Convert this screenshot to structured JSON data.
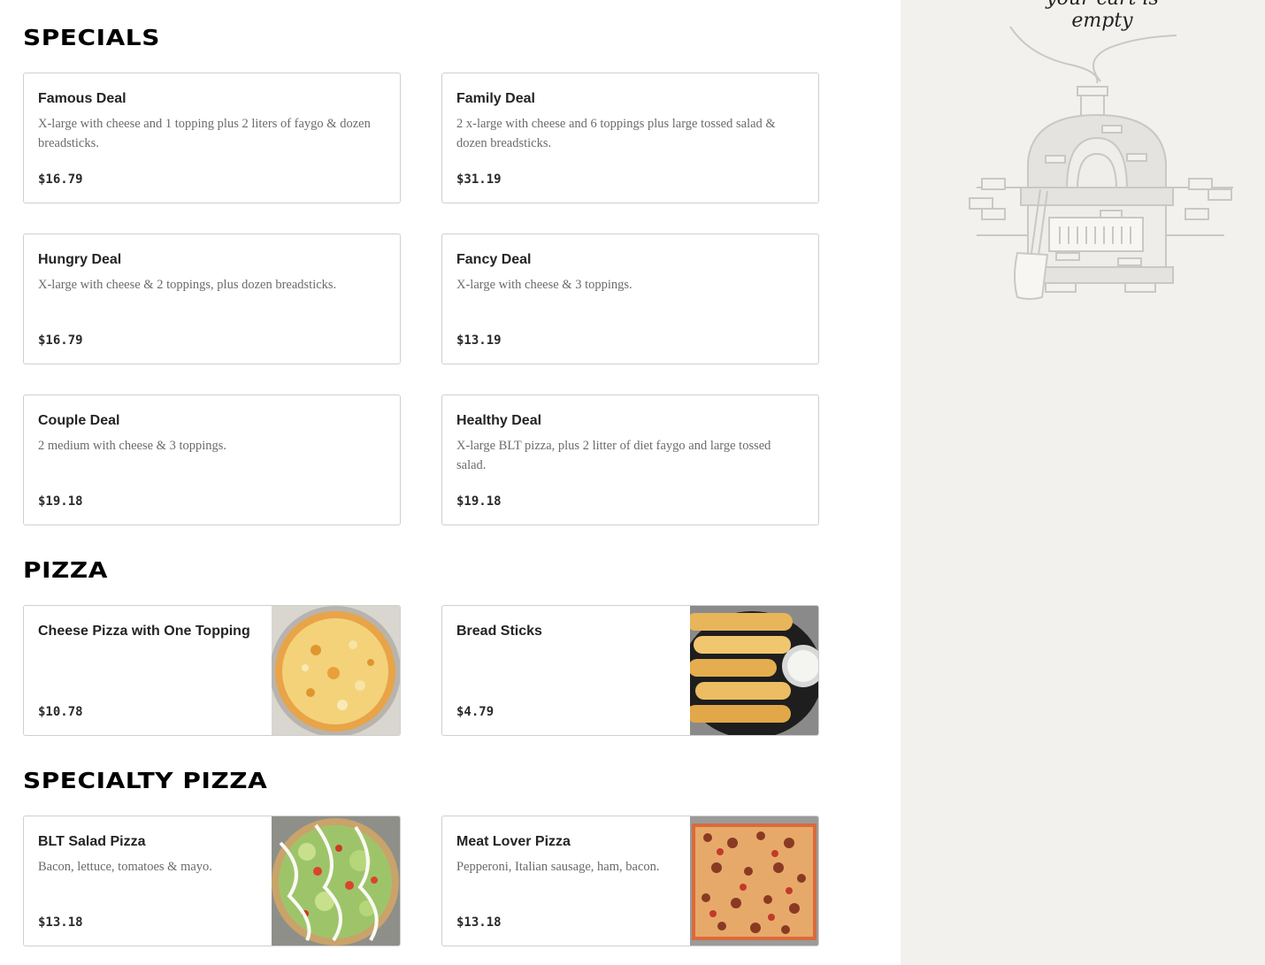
{
  "sections": [
    {
      "title": "SPECIALS",
      "items": [
        {
          "name": "Famous Deal",
          "desc": "X-large with cheese and 1 topping plus 2 liters of faygo & dozen breadsticks.",
          "price": "$16.79"
        },
        {
          "name": "Family Deal",
          "desc": "2 x-large with cheese and 6 toppings plus large tossed salad & dozen breadsticks.",
          "price": "$31.19"
        },
        {
          "name": "Hungry Deal",
          "desc": "X-large with cheese & 2 toppings, plus dozen breadsticks.",
          "price": "$16.79"
        },
        {
          "name": "Fancy Deal",
          "desc": "X-large with cheese & 3 toppings.",
          "price": "$13.19"
        },
        {
          "name": "Couple Deal",
          "desc": "2 medium with cheese & 3 toppings.",
          "price": "$19.18"
        },
        {
          "name": "Healthy Deal",
          "desc": "X-large BLT pizza, plus 2 litter of diet faygo and large tossed salad.",
          "price": "$19.18"
        }
      ]
    },
    {
      "title": "PIZZA",
      "items": [
        {
          "name": "Cheese Pizza with One Topping",
          "desc": "",
          "price": "$10.78",
          "image": "cheese-pizza-photo"
        },
        {
          "name": "Bread Sticks",
          "desc": "",
          "price": "$4.79",
          "image": "breadsticks-photo"
        }
      ]
    },
    {
      "title": "SPECIALTY PIZZA",
      "items": [
        {
          "name": "BLT Salad Pizza",
          "desc": "Bacon, lettuce, tomatoes & mayo.",
          "price": "$13.18",
          "image": "blt-pizza-photo"
        },
        {
          "name": "Meat Lover Pizza",
          "desc": "Pepperoni, Italian sausage, ham, bacon.",
          "price": "$13.18",
          "image": "meat-lover-pizza-photo"
        }
      ]
    }
  ],
  "cart": {
    "empty_text": "your cart is empty",
    "illustration": "pizza-oven-illustration"
  },
  "colors": {
    "sidebar_bg": "#f2f1ee",
    "card_border": "#cfcfcf",
    "desc_text": "#6b6b6b"
  }
}
